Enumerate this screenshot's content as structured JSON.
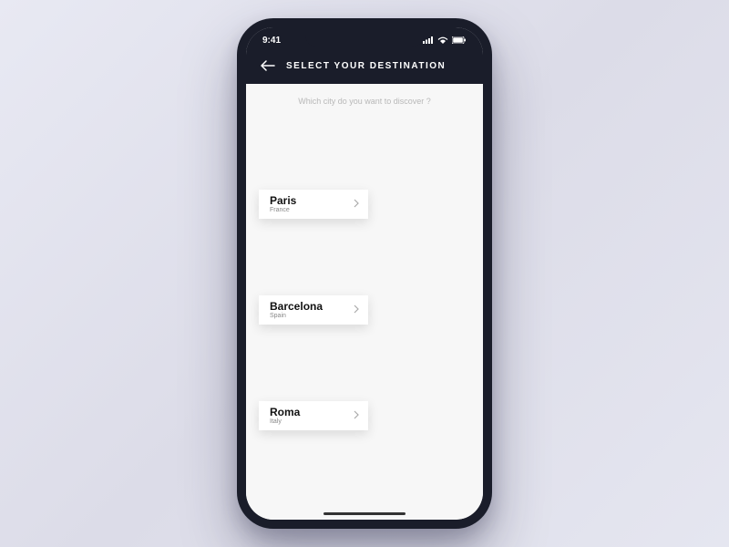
{
  "statusbar": {
    "time": "9:41"
  },
  "header": {
    "title": "SELECT YOUR DESTINATION"
  },
  "prompt": "Which city do you want to discover ?",
  "destinations": [
    {
      "city": "Paris",
      "country": "France"
    },
    {
      "city": "Barcelona",
      "country": "Spain"
    },
    {
      "city": "Roma",
      "country": "Italy"
    }
  ]
}
